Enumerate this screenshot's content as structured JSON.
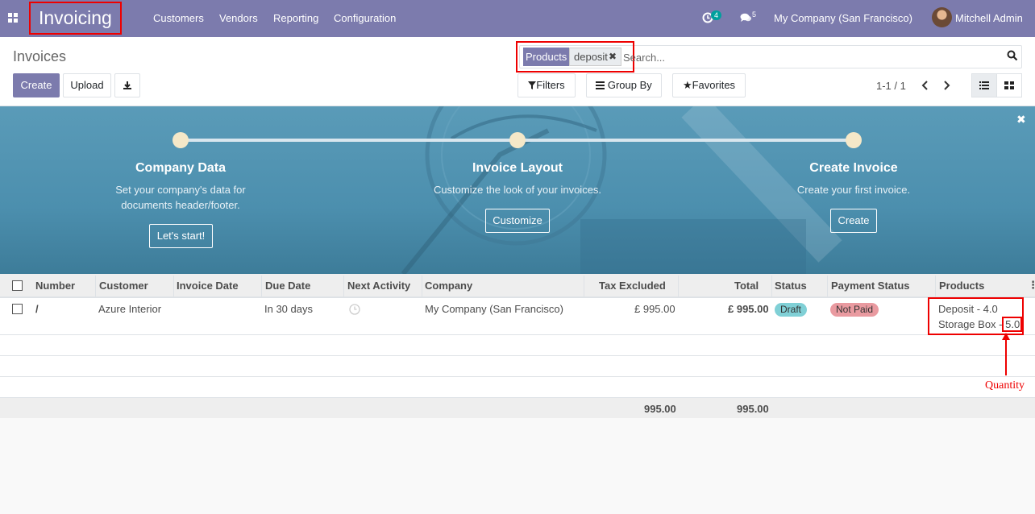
{
  "navbar": {
    "brand": "Invoicing",
    "menu": [
      {
        "label": "Customers"
      },
      {
        "label": "Vendors"
      },
      {
        "label": "Reporting"
      },
      {
        "label": "Configuration"
      }
    ],
    "activity_count": "4",
    "messages_count": "5",
    "company": "My Company (San Francisco)",
    "user": "Mitchell Admin",
    "accent_color": "#7c7bad"
  },
  "control_panel": {
    "title": "Invoices",
    "create_label": "Create",
    "upload_label": "Upload",
    "search": {
      "facet_label": "Products",
      "facet_value": "deposit",
      "placeholder": "Search..."
    },
    "filters_label": "Filters",
    "group_by_label": "Group By",
    "favorites_label": "Favorites",
    "pager": "1-1 / 1"
  },
  "banner": {
    "steps": [
      {
        "title": "Company Data",
        "description": "Set your company's data for documents header/footer.",
        "button": "Let's start!"
      },
      {
        "title": "Invoice Layout",
        "description": "Customize the look of your invoices.",
        "button": "Customize"
      },
      {
        "title": "Create Invoice",
        "description": "Create your first invoice.",
        "button": "Create"
      }
    ]
  },
  "table": {
    "columns": [
      "Number",
      "Customer",
      "Invoice Date",
      "Due Date",
      "Next Activity",
      "Company",
      "Tax Excluded",
      "Total",
      "Status",
      "Payment Status",
      "Products"
    ],
    "rows": [
      {
        "number": "/",
        "customer": "Azure Interior",
        "invoice_date": "",
        "due_date": "In 30 days",
        "company": "My Company (San Francisco)",
        "tax_excluded": "£ 995.00",
        "total": "£ 995.00",
        "status": "Draft",
        "payment_status": "Not Paid",
        "products": [
          "Deposit - 4.0",
          "Storage Box - 5.0"
        ]
      }
    ],
    "totals": {
      "tax_excluded": "995.00",
      "total": "995.00"
    },
    "status_colors": {
      "draft": "#80d0d6",
      "not_paid": "#e99aa0"
    }
  },
  "annotation": {
    "label": "Quantity"
  }
}
